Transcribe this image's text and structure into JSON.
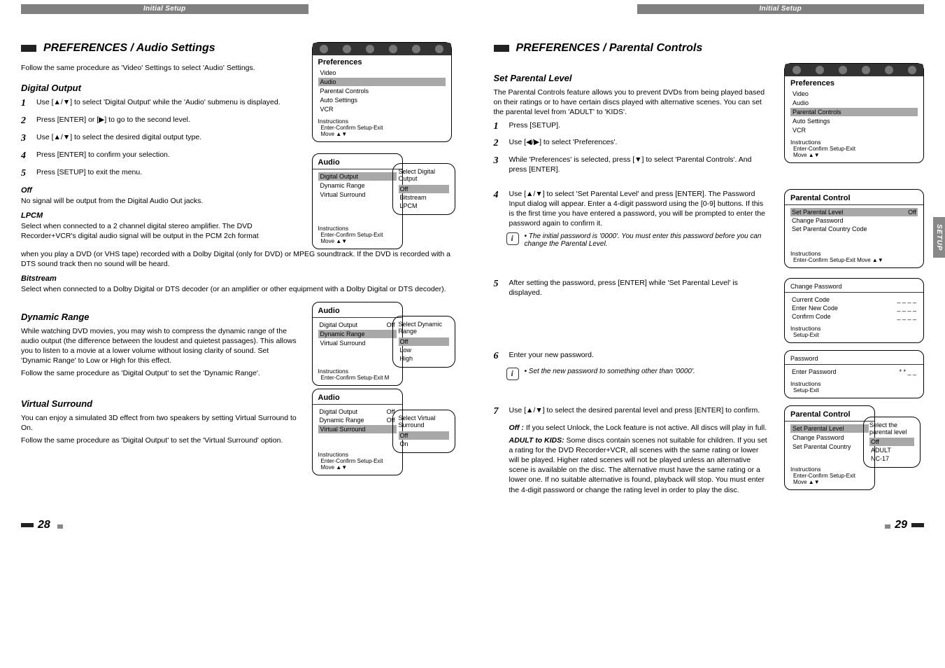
{
  "header": {
    "left": "Initial Setup",
    "right": "Initial Setup"
  },
  "sidetab": "SETUP",
  "pages": {
    "left": "28",
    "right": "29"
  },
  "left": {
    "title": "PREFERENCES / Audio Settings",
    "intro": "Follow the same procedure as 'Video' Settings to select 'Audio' Settings.",
    "digital_output": {
      "heading": "Digital Output",
      "steps": [
        "Use [▲/▼] to select 'Digital Output' while the 'Audio' submenu is displayed.",
        "Press [ENTER] or [▶] to go to the second level.",
        "Use [▲/▼] to select the desired digital output type.",
        "Press [ENTER] to confirm your selection.",
        "Press [SETUP] to exit the menu."
      ],
      "off_h": "Off",
      "off_p": "No signal will be output from the Digital Audio Out jacks.",
      "lpcm_h": "LPCM",
      "lpcm_p1": "Select when connected to a 2 channel digital stereo amplifier. The DVD Recorder+VCR's digital audio signal will be output in the PCM 2ch format",
      "lpcm_p2": "when you play a DVD (or VHS tape) recorded with a Dolby Digital (only for DVD) or MPEG soundtrack. If the DVD is recorded with a DTS sound track then no sound will be heard.",
      "bits_h": "Bitstream",
      "bits_p": "Select when connected to a Dolby Digital or DTS decoder (or an amplifier or other equipment with a Dolby Digital or DTS decoder)."
    },
    "dynamic_range": {
      "heading": "Dynamic Range",
      "p1": "While watching DVD movies, you may wish to compress the dynamic range of the audio output (the difference between the loudest and quietest passages). This allows you to listen to a movie at a lower volume without losing clarity of sound. Set 'Dynamic Range' to Low or High for this effect.",
      "p2": "Follow the same procedure as 'Digital Output' to set the 'Dynamic Range'."
    },
    "virtual_surround": {
      "heading": "Virtual Surround",
      "p1": "You can enjoy a simulated 3D effect from two speakers by setting Virtual Surround to On.",
      "p2": "Follow the same procedure as 'Digital Output' to set the 'Virtual Surround' option."
    },
    "menu_prefs": {
      "title": "Preferences",
      "items": [
        "Video",
        "Audio",
        "Parental Controls",
        "Auto Settings",
        "VCR"
      ],
      "instr_line1": "Instructions",
      "instr_line2": "Enter-Confirm   Setup-Exit",
      "instr_line3": "Move ▲▼"
    },
    "menu_audio1": {
      "title": "Audio",
      "rows": [
        "Digital Output",
        "Dynamic Range",
        "Virtual Surround"
      ],
      "vals_label": "Select Digital Output",
      "opts": [
        "Off",
        "Bitstream",
        "LPCM"
      ],
      "instr1": "Instructions",
      "instr2": "Enter-Confirm  Setup-Exit  Move ▲▼"
    },
    "menu_audio2": {
      "title": "Audio",
      "rows": [
        "Digital Output",
        "Dynamic Range",
        "Virtual Surround"
      ],
      "val0": "Off",
      "vals_label": "Select Dynamic Range",
      "opts": [
        "Off",
        "Low",
        "High"
      ],
      "instr1": "Instructions",
      "instr2": "Enter-Confirm  Setup-Exit  M"
    },
    "menu_audio3": {
      "title": "Audio",
      "rows": [
        "Digital Output",
        "Dynamic Range",
        "Virtual Surround"
      ],
      "val0": "Off",
      "val1": "Off",
      "vals_label": "Select Virtual Surround",
      "opts": [
        "Off",
        "On"
      ],
      "instr1": "Instructions",
      "instr2": "Enter-Confirm  Setup-Exit  Move ▲▼"
    }
  },
  "right": {
    "title": "PREFERENCES / Parental Controls",
    "set_parental": {
      "heading": "Set Parental Level",
      "intro": "The Parental Controls feature allows you to prevent DVDs from being played based on their ratings or to have certain discs played with alternative scenes. You can set the parental level from 'ADULT' to 'KIDS'.",
      "steps123": [
        "Press [SETUP].",
        "Use [◀/▶] to select 'Preferences'.",
        "While 'Preferences' is selected, press [▼] to select 'Parental Controls'. And press [ENTER]."
      ],
      "step4": "Use [▲/▼] to select 'Set Parental Level' and press [ENTER].  The Password Input dialog will appear. Enter a 4-digit password using the [0-9] buttons. If this is the first time you have entered a password, you will be prompted to enter the password again to confirm it.",
      "tip4": "The initial password is '0000'. You must enter this password before you can change the Parental Level.",
      "step5": "After setting the password, press [ENTER] while 'Set Parental Level' is displayed.",
      "step6": "Enter your new password.",
      "tip6": "Set the new password to something other than '0000'.",
      "step7": "Use [▲/▼] to select the desired parental level and press [ENTER] to confirm.",
      "off_h": "Off :",
      "off_p": "If you select Unlock, the Lock feature is not active. All discs will play in full.",
      "adult_h": "ADULT to KIDS:",
      "adult_p": "Some discs contain scenes not suitable for children. If you set a rating for the DVD Recorder+VCR, all scenes with the same rating or lower will be played. Higher rated scenes will not be played unless an alternative scene is available on the disc. The alternative must have the same rating or a lower one. If no suitable alternative is found, playback will stop. You must enter the 4-digit password or change the rating level in order to play the disc."
    },
    "menu_prefs": {
      "title": "Preferences",
      "items": [
        "Video",
        "Audio",
        "Parental Controls",
        "Auto Settings",
        "VCR"
      ],
      "instr_line1": "Instructions",
      "instr_line2": "Enter-Confirm   Setup-Exit",
      "instr_line3": "Move ▲▼"
    },
    "menu_pc1": {
      "title": "Parental Control",
      "rows": [
        [
          "Set Parental Level",
          "Off"
        ],
        [
          "Change Password",
          ""
        ],
        [
          "Set Parental Country Code",
          ""
        ]
      ],
      "instr1": "Instructions",
      "instr2": "Enter-Confirm  Setup-Exit  Move ▲▼"
    },
    "menu_cp": {
      "title": "Change Password",
      "rows": [
        "Current Code",
        "Enter New Code",
        "Confirm Code"
      ],
      "dashes": "_ _ _ _",
      "instr1": "Instructions",
      "instr2": "Setup-Exit"
    },
    "menu_pw": {
      "title": "Password",
      "row": "Enter Password",
      "mask": "* * _ _",
      "instr1": "Instructions",
      "instr2": "Setup-Exit"
    },
    "menu_pc2": {
      "title": "Parental Control",
      "rows": [
        "Set Parental Level",
        "Change Password",
        "Set Parental Country"
      ],
      "bubble_label": "Select the parental level",
      "opts": [
        "Off",
        "ADULT",
        "NC-17"
      ],
      "instr1": "Instructions",
      "instr2": "Enter-Confirm  Setup-Exit  Move ▲▼"
    }
  }
}
